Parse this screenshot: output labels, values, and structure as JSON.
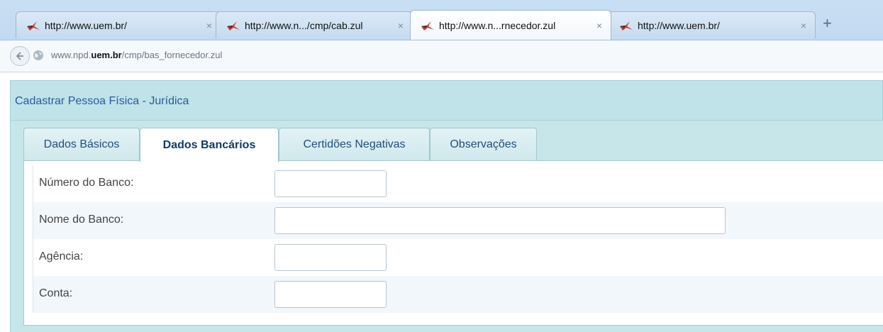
{
  "browser": {
    "tabs": [
      {
        "title": "http://www.uem.br/",
        "close": "×"
      },
      {
        "title": "http://www.n.../cmp/cab.zul",
        "close": "×"
      },
      {
        "title": "http://www.n...rnecedor.zul",
        "close": "×"
      },
      {
        "title": "http://www.uem.br/",
        "close": "×"
      }
    ],
    "new_tab": "+",
    "url": {
      "prefix": "www.npd.",
      "domain": "uem.br",
      "path": "/cmp/bas_fornecedor.zul"
    },
    "active_tab_index": 2
  },
  "app": {
    "title": "Cadastrar Pessoa Física - Jurídica",
    "tabs": [
      {
        "label": "Dados Básicos"
      },
      {
        "label": "Dados Bancários"
      },
      {
        "label": "Certidões Negativas"
      },
      {
        "label": "Observações"
      }
    ],
    "selected_tab": "Dados Bancários",
    "form": {
      "fields": [
        {
          "label": "Número do Banco:",
          "value": ""
        },
        {
          "label": "Nome do Banco:",
          "value": ""
        },
        {
          "label": "Agência:",
          "value": ""
        },
        {
          "label": "Conta:",
          "value": ""
        }
      ]
    }
  },
  "colors": {
    "header_bg": "#bfe3e8",
    "title_text": "#2b5aa0",
    "tab_text": "#1f4f7a"
  }
}
